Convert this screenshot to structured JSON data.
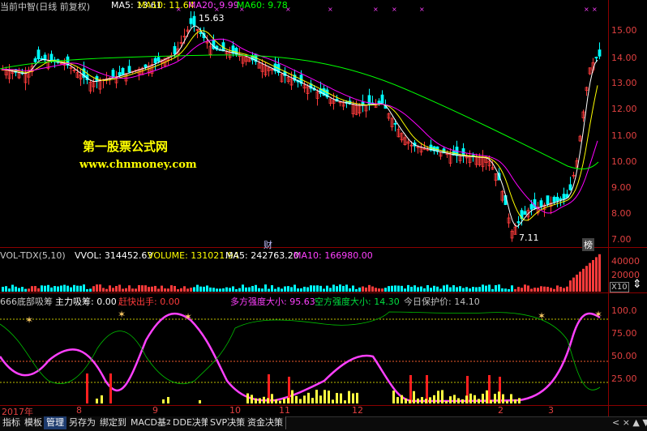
{
  "colors": {
    "up": "#ff3b3b",
    "down": "#00ffff",
    "ma5": "#ffffff",
    "ma10": "#ffff00",
    "ma20": "#ff00ff",
    "ma60": "#00ff00",
    "text_magenta": "#ff40ff",
    "text_yellow": "#ffff00",
    "text_cyan": "#00e0e0"
  },
  "main": {
    "title": "当前中智(日线 前复权)",
    "ma5_label": "MA5: 13.61",
    "ma10_label": "MA10: 11.64",
    "ma20_label": "MA20: 9.99",
    "ma60_label": "MA60: 9.78",
    "high_marker": "15.63",
    "low_marker": "7.11",
    "watermark_cn": "第一股票公式网",
    "watermark_url": "www.chnmoney.com",
    "event_cai": "财",
    "event_bang": "榜",
    "y_ticks": [
      "15.00",
      "14.00",
      "13.00",
      "12.00",
      "11.00",
      "10.00",
      "9.00",
      "8.00",
      "7.00"
    ]
  },
  "volume": {
    "label": "VOL-TDX(5,10)",
    "vvol": "VVOL: 314452.63",
    "volume": "VOLUME: 131021.94",
    "ma5": "MA5: 242763.20",
    "ma10": "MA10: 166980.00",
    "y_ticks": [
      "40000",
      "20000"
    ],
    "unit": "X10"
  },
  "indicator": {
    "name": "666底部吸筹",
    "main_buy": "主力吸筹: 0.00",
    "sell_signal": "赶快出手: 0.00",
    "bull_strength": "多方强度大小: 95.63",
    "bear_strength": "空方强度大小: 14.30",
    "today_price": "今日保护价: 14.10",
    "y_ticks": [
      "100.0",
      "75.00",
      "50.00",
      "25.00"
    ]
  },
  "months": [
    "2017年",
    "8",
    "9",
    "10",
    "11",
    "12",
    "2",
    "3"
  ],
  "tabs": [
    "指标",
    "模板",
    "管理",
    "另存为",
    "绑定到",
    "MACD基本",
    "DDE决策",
    "SVP决策",
    "资金决策"
  ],
  "active_tab": "管理"
}
